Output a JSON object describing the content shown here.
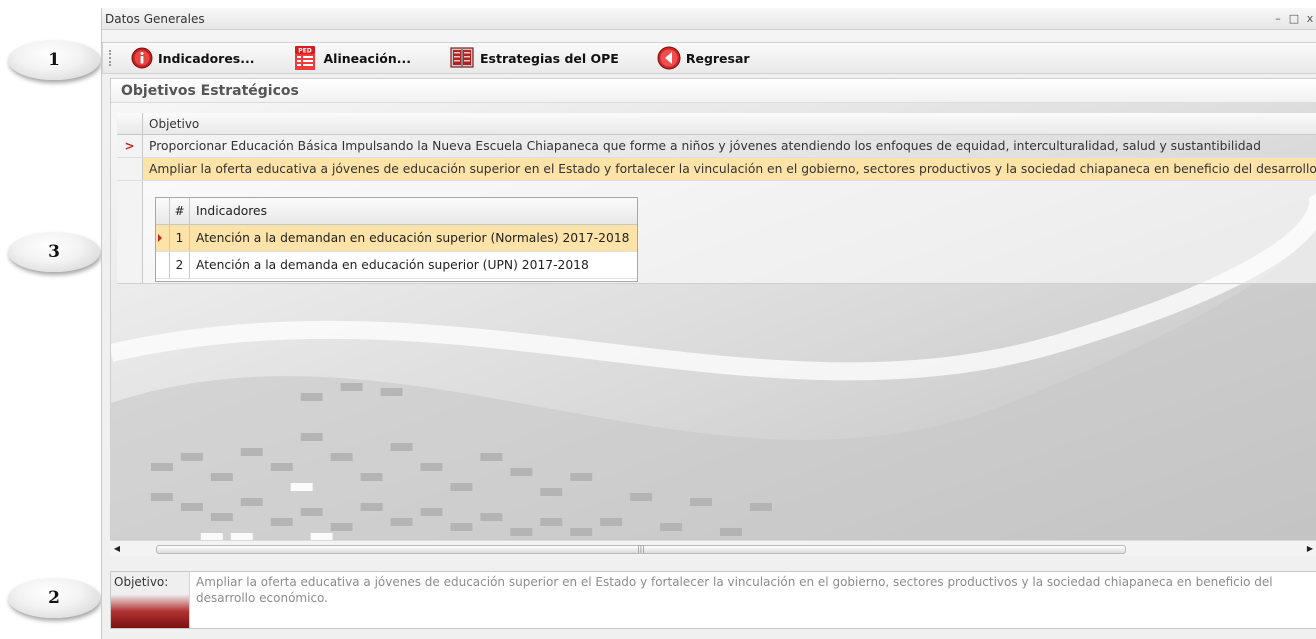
{
  "callouts": {
    "one": "1",
    "three": "3",
    "two": "2"
  },
  "window": {
    "title": "Datos Generales",
    "controls": [
      "–",
      "□",
      "x"
    ]
  },
  "toolbar": {
    "buttons": [
      {
        "label": "Indicadores...",
        "icon": "info-icon"
      },
      {
        "label": "Alineación...",
        "icon": "ped-document-icon"
      },
      {
        "label": "Estrategias del OPE",
        "icon": "book-icon"
      },
      {
        "label": "Regresar",
        "icon": "back-arrow-icon"
      }
    ]
  },
  "section_title": "Objetivos Estratégicos",
  "grid": {
    "column": "Objetivo",
    "rows": [
      "Proporcionar Educación Básica Impulsando la Nueva Escuela Chiapaneca que forme a niños y jóvenes atendiendo los enfoques de equidad, interculturalidad, salud y sustantibilidad",
      "Ampliar la oferta educativa a jóvenes de educación superior en el Estado y fortalecer la vinculación en el gobierno, sectores productivos y la sociedad chiapaneca en beneficio del desarrollo económico."
    ],
    "current_marker": ">"
  },
  "subgrid": {
    "col_num": "#",
    "col_name": "Indicadores",
    "rows": [
      {
        "num": "1",
        "name": "Atención a la demandan en educación superior (Normales) 2017-2018"
      },
      {
        "num": "2",
        "name": "Atención a la demanda en educación superior (UPN) 2017-2018"
      }
    ]
  },
  "detail": {
    "label": "Objetivo:",
    "text": "Ampliar la oferta educativa a jóvenes de educación superior en el Estado y fortalecer la vinculación en el gobierno, sectores productivos y la sociedad chiapaneca en beneficio del desarrollo económico."
  },
  "colors": {
    "selected_row": "#fde3a7",
    "marker": "#c62828",
    "detail_label_gradient": "#b23333"
  }
}
